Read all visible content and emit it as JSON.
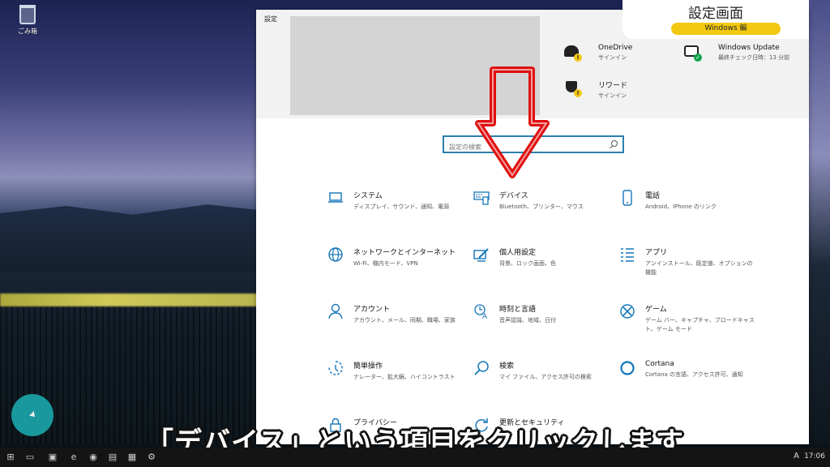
{
  "desktop": {
    "recycle_bin_label": "ごみ箱"
  },
  "window": {
    "title": "設定",
    "status": [
      {
        "title": "OneDrive",
        "sub": "サインイン",
        "icon": "cloud-icon",
        "badge": "!"
      },
      {
        "title": "Windows Update",
        "sub": "最終チェック日時：13 分前",
        "icon": "update-icon",
        "badge": "✓"
      },
      {
        "title": "リワード",
        "sub": "サインイン",
        "icon": "trophy-icon",
        "badge": "!"
      }
    ],
    "search_placeholder": "設定の検索",
    "categories": [
      {
        "name": "システム",
        "desc": "ディスプレイ、サウンド、通知、電源",
        "icon": "laptop-icon"
      },
      {
        "name": "デバイス",
        "desc": "Bluetooth、プリンター、マウス",
        "icon": "keyboard-icon"
      },
      {
        "name": "電話",
        "desc": "Android、iPhone のリンク",
        "icon": "phone-icon"
      },
      {
        "name": "ネットワークとインターネット",
        "desc": "Wi-Fi、機内モード、VPN",
        "icon": "globe-icon"
      },
      {
        "name": "個人用設定",
        "desc": "背景、ロック画面、色",
        "icon": "paint-icon"
      },
      {
        "name": "アプリ",
        "desc": "アンインストール、既定値、オプションの機能",
        "icon": "apps-list-icon"
      },
      {
        "name": "アカウント",
        "desc": "アカウント、メール、同期、職場、家族",
        "icon": "person-icon"
      },
      {
        "name": "時刻と言語",
        "desc": "音声認識、地域、日付",
        "icon": "time-language-icon"
      },
      {
        "name": "ゲーム",
        "desc": "ゲーム バー、キャプチャ、ブロードキャスト、ゲーム モード",
        "icon": "xbox-icon"
      },
      {
        "name": "簡単操作",
        "desc": "ナレーター、拡大鏡、ハイコントラスト",
        "icon": "ease-of-access-icon"
      },
      {
        "name": "検索",
        "desc": "マイ ファイル、アクセス許可の検索",
        "icon": "search-icon"
      },
      {
        "name": "Cortana",
        "desc": "Cortana の言語、アクセス許可、通知",
        "icon": "cortana-icon"
      },
      {
        "name": "プライバシー",
        "desc": "",
        "icon": "lock-icon"
      },
      {
        "name": "更新とセキュリティ",
        "desc": "",
        "icon": "refresh-icon"
      }
    ]
  },
  "overlay": {
    "title": "設定画面",
    "tag": "Windows 編",
    "caption": "「デバイス」という項目をクリックします"
  },
  "taskbar": {
    "time": "17:06",
    "ime": "A"
  },
  "colors": {
    "accent": "#1476b8",
    "arrow": "#e01010",
    "pill": "#f2c811"
  }
}
